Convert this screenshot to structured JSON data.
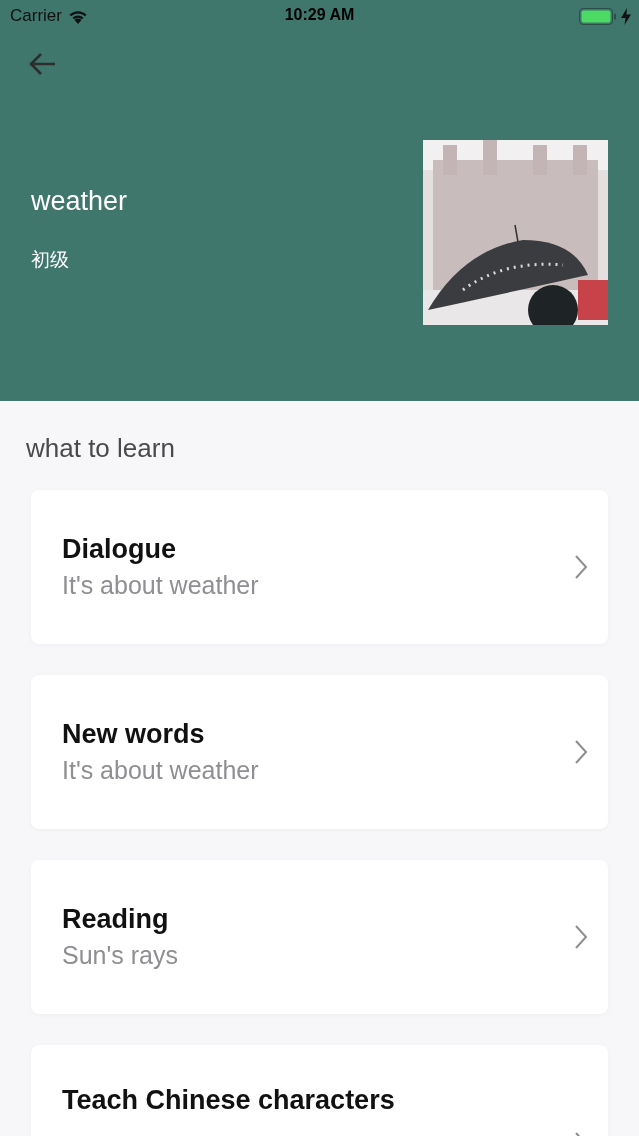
{
  "status_bar": {
    "carrier": "Carrier",
    "time": "10:29 AM"
  },
  "header": {
    "title": "weather",
    "level": "初级"
  },
  "section_title": "what to learn",
  "lessons": [
    {
      "title": "Dialogue",
      "subtitle": "It's about weather"
    },
    {
      "title": "New words",
      "subtitle": "It's about weather"
    },
    {
      "title": "Reading",
      "subtitle": "Sun's rays"
    },
    {
      "title": "Teach Chinese characters"
    }
  ]
}
